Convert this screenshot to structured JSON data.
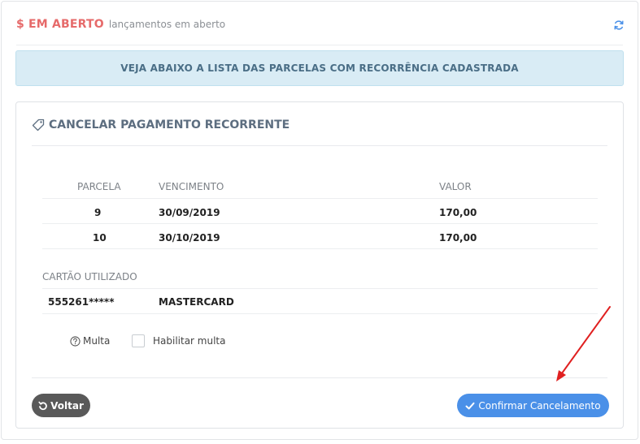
{
  "header": {
    "title": "$ EM ABERTO",
    "subtitle": "lançamentos em aberto",
    "refresh_icon": "refresh-icon"
  },
  "banner": {
    "text": "VEJA ABAIXO A LISTA DAS PARCELAS COM RECORRÊNCIA CADASTRADA",
    "color": "#d9ecf5"
  },
  "panel": {
    "title": "CANCELAR PAGAMENTO RECORRENTE",
    "title_icon": "tag-icon",
    "table": {
      "columns": [
        "PARCELA",
        "VENCIMENTO",
        "VALOR"
      ],
      "rows": [
        {
          "parcela": "9",
          "vencimento": "30/09/2019",
          "valor": "170,00"
        },
        {
          "parcela": "10",
          "vencimento": "30/10/2019",
          "valor": "170,00"
        }
      ]
    },
    "card": {
      "heading": "CARTÃO UTILIZADO",
      "number": "555261*****",
      "brand": "MASTERCARD"
    },
    "multa_label": "Multa",
    "habilitar_multa_label": "Habilitar multa",
    "habilitar_multa_checked": false
  },
  "buttons": {
    "voltar": "Voltar",
    "confirmar": "Confirmar Cancelamento",
    "voltar_color": "#595959",
    "confirmar_color": "#4a90e8"
  },
  "annotation": {
    "arrow_color": "#e02020"
  }
}
